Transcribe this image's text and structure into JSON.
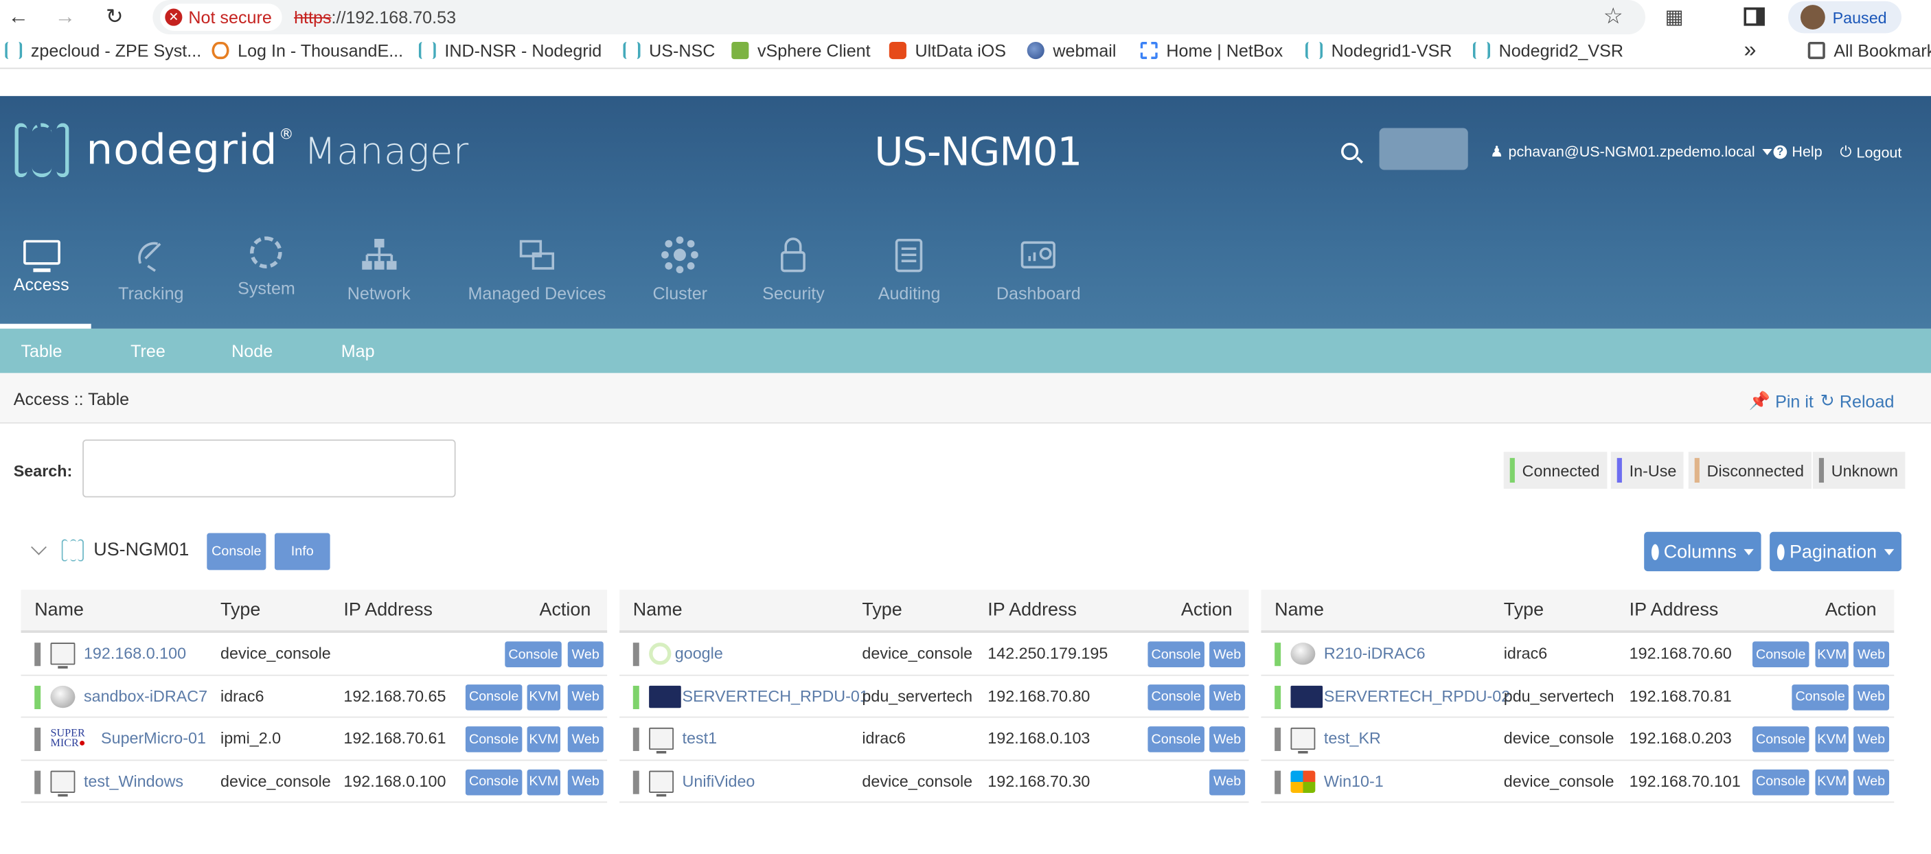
{
  "browser": {
    "security_chip": "Not secure",
    "url_scheme": "https",
    "url_rest": "://192.168.70.53",
    "profile_label": "Paused",
    "bookmarks": [
      {
        "label": "zpecloud - ZPE Syst...",
        "icon": "nodegrid-icon"
      },
      {
        "label": "Log In - ThousandE...",
        "icon": "eye-icon"
      },
      {
        "label": "IND-NSR - Nodegrid",
        "icon": "nodegrid-icon"
      },
      {
        "label": "US-NSC",
        "icon": "nodegrid-icon"
      },
      {
        "label": "vSphere Client",
        "icon": "vsphere-icon"
      },
      {
        "label": "UltData iOS",
        "icon": "ultdata-icon"
      },
      {
        "label": "webmail",
        "icon": "webmail-icon"
      },
      {
        "label": "Home | NetBox",
        "icon": "netbox-icon"
      },
      {
        "label": "Nodegrid1-VSR",
        "icon": "nodegrid-icon"
      },
      {
        "label": "Nodegrid2_VSR",
        "icon": "nodegrid-icon"
      }
    ],
    "more_bookmarks": "»",
    "all_bookmarks": "All Bookmarks"
  },
  "app": {
    "brand": "nodegrid",
    "brand_mark": "®",
    "product": "Manager",
    "hostname": "US-NGM01",
    "user": "pchavan@US-NGM01.zpedemo.local",
    "help": "Help",
    "logout": "Logout"
  },
  "main_nav": [
    {
      "label": "Access",
      "icon": "monitor-icon",
      "active": true
    },
    {
      "label": "Tracking",
      "icon": "satellite-icon",
      "active": false
    },
    {
      "label": "System",
      "icon": "gear-icon",
      "active": false
    },
    {
      "label": "Network",
      "icon": "network-icon",
      "active": false
    },
    {
      "label": "Managed Devices",
      "icon": "devices-icon",
      "active": false
    },
    {
      "label": "Cluster",
      "icon": "cluster-icon",
      "active": false
    },
    {
      "label": "Security",
      "icon": "lock-icon",
      "active": false
    },
    {
      "label": "Auditing",
      "icon": "clipboard-icon",
      "active": false
    },
    {
      "label": "Dashboard",
      "icon": "dashboard-icon",
      "active": false
    }
  ],
  "sub_nav": [
    "Table",
    "Tree",
    "Node",
    "Map"
  ],
  "breadcrumb": "Access :: Table",
  "pin_it": "Pin it",
  "reload": "Reload",
  "search_label": "Search:",
  "legend": [
    {
      "label": "Connected",
      "color": "#7ed36b"
    },
    {
      "label": "In-Use",
      "color": "#6d6df0"
    },
    {
      "label": "Disconnected",
      "color": "#e0b48a"
    },
    {
      "label": "Unknown",
      "color": "#8a8a8a"
    }
  ],
  "node": {
    "name": "US-NGM01",
    "console_btn": "Console",
    "info_btn": "Info",
    "columns_btn": "Columns",
    "pagination_btn": "Pagination"
  },
  "table_headers": {
    "name": "Name",
    "type": "Type",
    "ip": "IP Address",
    "action": "Action"
  },
  "tables": [
    {
      "rows": [
        {
          "status": "#8a8a8a",
          "icon": "screen-icon",
          "name": "192.168.0.100",
          "type": "device_console",
          "ip": "",
          "actions": [
            "Console",
            "Web"
          ]
        },
        {
          "status": "#7ed36b",
          "icon": "dell-icon",
          "name": "sandbox-iDRAC7",
          "type": "idrac6",
          "ip": "192.168.70.65",
          "actions": [
            "Console",
            "KVM",
            "Web"
          ]
        },
        {
          "status": "#8a8a8a",
          "icon": "supermicro-icon",
          "name": "SuperMicro-01",
          "type": "ipmi_2.0",
          "ip": "192.168.70.61",
          "actions": [
            "Console",
            "KVM",
            "Web"
          ]
        },
        {
          "status": "#8a8a8a",
          "icon": "screen-icon",
          "name": "test_Windows",
          "type": "device_console",
          "ip": "192.168.0.100",
          "actions": [
            "Console",
            "KVM",
            "Web"
          ]
        }
      ]
    },
    {
      "rows": [
        {
          "status": "#8a8a8a",
          "icon": "google-icon",
          "name": "google",
          "type": "device_console",
          "ip": "142.250.179.195",
          "actions": [
            "Console",
            "Web"
          ]
        },
        {
          "status": "#7ed36b",
          "icon": "pdu-icon",
          "name": "SERVERTECH_RPDU-01",
          "type": "pdu_servertech",
          "ip": "192.168.70.80",
          "actions": [
            "Console",
            "Web"
          ]
        },
        {
          "status": "#8a8a8a",
          "icon": "screen-icon",
          "name": "test1",
          "type": "idrac6",
          "ip": "192.168.0.103",
          "actions": [
            "Console",
            "Web"
          ]
        },
        {
          "status": "#8a8a8a",
          "icon": "screen-icon",
          "name": "UnifiVideo",
          "type": "device_console",
          "ip": "192.168.70.30",
          "actions": [
            "Web"
          ]
        }
      ]
    },
    {
      "rows": [
        {
          "status": "#7ed36b",
          "icon": "dell-icon",
          "name": "R210-iDRAC6",
          "type": "idrac6",
          "ip": "192.168.70.60",
          "actions": [
            "Console",
            "KVM",
            "Web"
          ]
        },
        {
          "status": "#7ed36b",
          "icon": "pdu-icon",
          "name": "SERVERTECH_RPDU-02",
          "type": "pdu_servertech",
          "ip": "192.168.70.81",
          "actions": [
            "Console",
            "Web"
          ]
        },
        {
          "status": "#8a8a8a",
          "icon": "screen-icon",
          "name": "test_KR",
          "type": "device_console",
          "ip": "192.168.0.203",
          "actions": [
            "Console",
            "KVM",
            "Web"
          ]
        },
        {
          "status": "#8a8a8a",
          "icon": "windows-icon",
          "name": "Win10-1",
          "type": "device_console",
          "ip": "192.168.70.101",
          "actions": [
            "Console",
            "KVM",
            "Web"
          ]
        }
      ]
    }
  ]
}
